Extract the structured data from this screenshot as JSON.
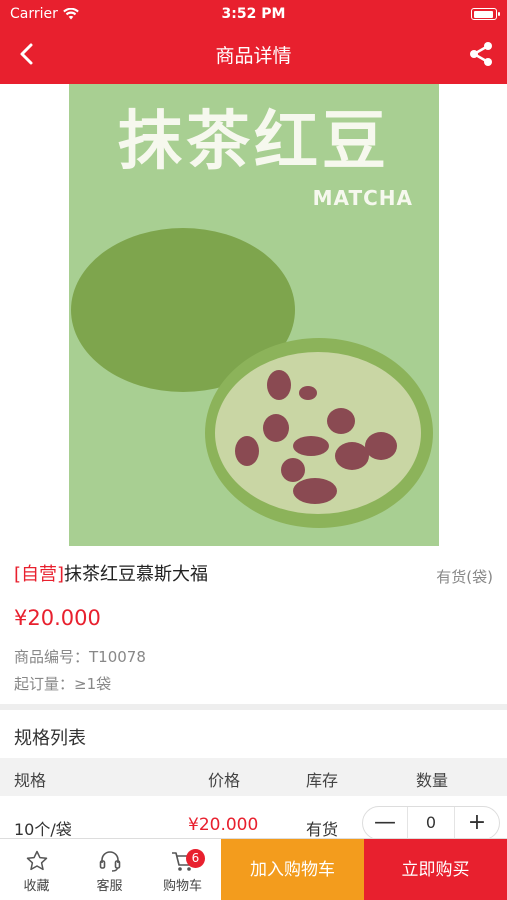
{
  "status_bar": {
    "carrier": "Carrier",
    "time": "3:52 PM"
  },
  "navbar": {
    "title": "商品详情"
  },
  "hero_image": {
    "brand_text": "抹茶红豆",
    "sub_text": "MATCHA"
  },
  "product": {
    "tag": "[自营]",
    "name": "抹茶红豆慕斯大福",
    "stock": "有货(袋)",
    "price": "¥20.000",
    "code": "商品编号：T10078",
    "min_order": "起订量：≥1袋"
  },
  "specs": {
    "title": "规格列表",
    "headers": [
      "规格",
      "价格",
      "库存",
      "数量"
    ],
    "rows": [
      {
        "spec": "10个/袋",
        "price": "¥20.000",
        "stock": "有货",
        "qty": "0",
        "minus": "—",
        "plus": "+"
      }
    ]
  },
  "bottom_bar": {
    "favorite": "收藏",
    "service": "客服",
    "cart": "购物车",
    "cart_count": "6",
    "add_to_cart": "加入购物车",
    "buy_now": "立即购买"
  },
  "colors": {
    "brand_red": "#e8202e",
    "cart_orange": "#f39c1d"
  },
  "icons": [
    "wifi-icon",
    "battery-icon",
    "back-arrow-icon",
    "share-icon",
    "star-icon",
    "headset-icon",
    "cart-icon"
  ]
}
